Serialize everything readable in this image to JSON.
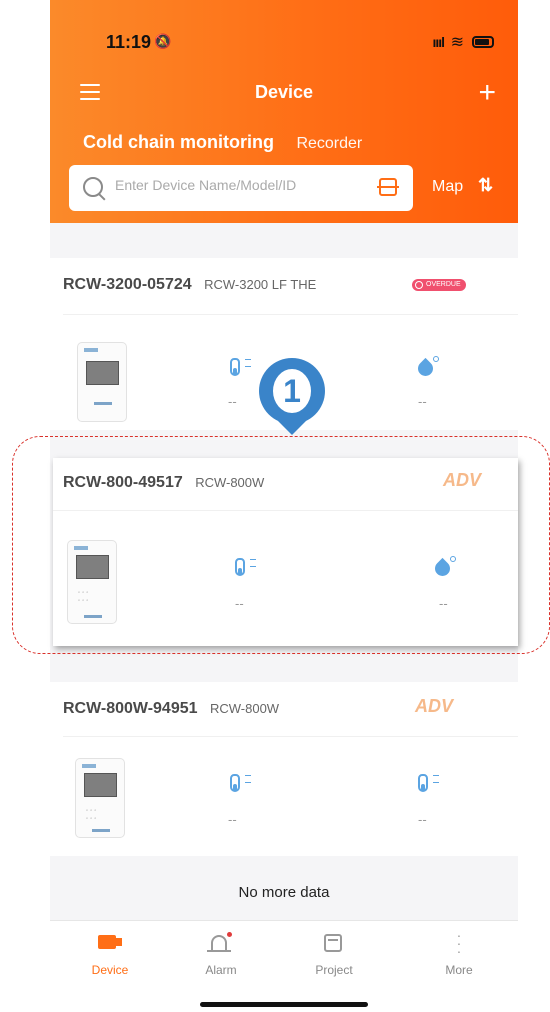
{
  "status_bar": {
    "time": "11:19"
  },
  "navbar": {
    "title": "Device"
  },
  "tabs": {
    "active": "Cold chain monitoring",
    "other": "Recorder"
  },
  "search": {
    "placeholder": "Enter Device Name/Model/ID"
  },
  "map_label": "Map",
  "devices": [
    {
      "id": "RCW-3200-05724",
      "model": "RCW-3200 LF THE",
      "badge": "OVERDUE",
      "temp": "--",
      "humidity": "--"
    },
    {
      "id": "RCW-800-49517",
      "model": "RCW-800W",
      "badge": "ADV",
      "temp": "--",
      "humidity": "--"
    },
    {
      "id": "RCW-800W-94951",
      "model": "RCW-800W",
      "badge": "ADV",
      "temp": "--",
      "humidity": "--"
    }
  ],
  "annotation_number": "1",
  "no_more": "No more data",
  "tabbar": {
    "device": "Device",
    "alarm": "Alarm",
    "project": "Project",
    "more": "More"
  },
  "colors": {
    "accent": "#ff6e16",
    "highlight_dash": "#d9302a",
    "pin": "#3a84c9",
    "sensor_icon": "#5ba4e2"
  }
}
